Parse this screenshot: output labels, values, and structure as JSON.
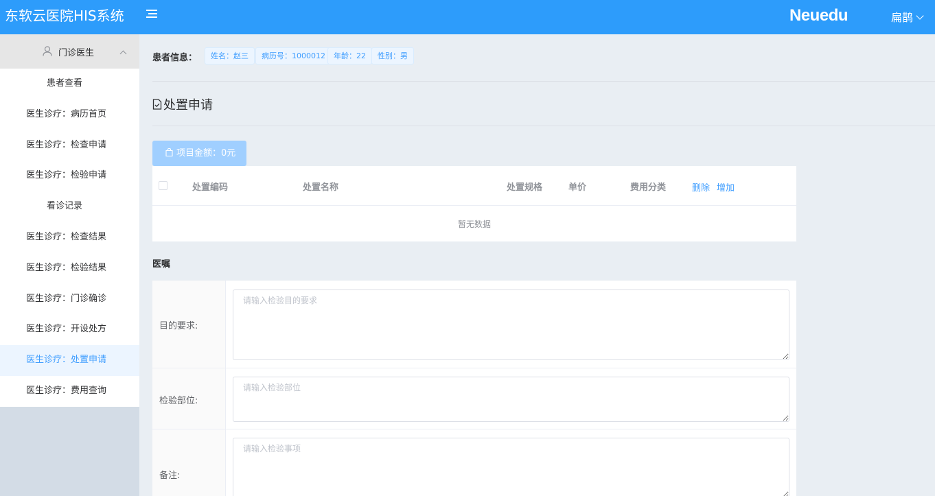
{
  "header": {
    "app_title": "东软云医院HIS系统",
    "brand": "Neuedu",
    "user_name": "扁鹊",
    "brand_color": "#2d9cfb"
  },
  "sidebar": {
    "group_label": "门诊医生",
    "items": [
      {
        "label": "患者查看"
      },
      {
        "label": "医生诊疗：病历首页"
      },
      {
        "label": "医生诊疗：检查申请"
      },
      {
        "label": "医生诊疗：检验申请"
      },
      {
        "label": "看诊记录"
      },
      {
        "label": "医生诊疗：检查结果"
      },
      {
        "label": "医生诊疗：检验结果"
      },
      {
        "label": "医生诊疗：门诊确诊"
      },
      {
        "label": "医生诊疗：开设处方"
      },
      {
        "label": "医生诊疗：处置申请"
      },
      {
        "label": "医生诊疗：费用查询"
      }
    ],
    "active_item": "医生诊疗：处置申请"
  },
  "patient": {
    "label": "患者信息：",
    "tags": {
      "name": "姓名：赵三",
      "record_no": "病历号：1000012",
      "age": "年龄：22",
      "gender": "性别：男"
    }
  },
  "page": {
    "title": "处置申请"
  },
  "amount_button": {
    "label": "项目金额：0元"
  },
  "table": {
    "columns": {
      "code": "处置编码",
      "name": "处置名称",
      "spec": "处置规格",
      "price": "单价",
      "category": "费用分类"
    },
    "delete_label": "删除",
    "add_label": "增加",
    "empty_text": "暂无数据",
    "rows": []
  },
  "orders": {
    "title": "医嘱",
    "fields": {
      "purpose": {
        "label": "目的要求:",
        "placeholder": "请输入检验目的要求",
        "value": ""
      },
      "site": {
        "label": "检验部位:",
        "placeholder": "请输入检验部位",
        "value": ""
      },
      "remark": {
        "label": "备注:",
        "placeholder": "请输入检验事项",
        "value": ""
      }
    }
  }
}
